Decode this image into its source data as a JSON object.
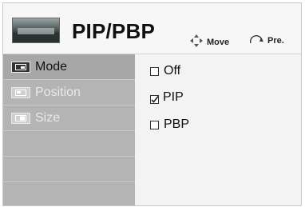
{
  "header": {
    "title": "PIP/PBP",
    "hints": [
      {
        "icon": "four-way-arrows-icon",
        "label": "Move"
      },
      {
        "icon": "return-arrow-icon",
        "label": "Pre."
      }
    ]
  },
  "menu": {
    "items": [
      {
        "label": "Mode",
        "state": "active",
        "icon": "mode-icon"
      },
      {
        "label": "Position",
        "state": "disabled",
        "icon": "position-icon"
      },
      {
        "label": "Size",
        "state": "disabled",
        "icon": "size-icon"
      },
      {
        "label": "",
        "state": "empty"
      },
      {
        "label": "",
        "state": "empty"
      },
      {
        "label": "",
        "state": "empty"
      }
    ]
  },
  "options": {
    "items": [
      {
        "label": "Off",
        "checked": false
      },
      {
        "label": "PIP",
        "checked": true
      },
      {
        "label": "PBP",
        "checked": false
      }
    ]
  },
  "colors": {
    "menu_bg": "#b4b4b4",
    "menu_active": "#a7a7a7",
    "options_bg": "#f3f3f3"
  }
}
